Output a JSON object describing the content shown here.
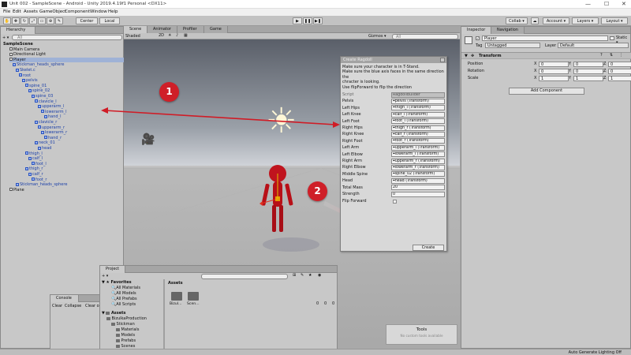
{
  "window": {
    "title": "Unit 002 - SampleScene - Android - Unity 2019.4.19f1 Personal <DX11>",
    "minimize": "—",
    "maximize": "☐",
    "close": "✕"
  },
  "menu": [
    "File",
    "Edit",
    "Assets",
    "GameObject",
    "Component",
    "Window",
    "Help"
  ],
  "toolbar": {
    "center_label": "Center",
    "local_label": "Local",
    "collab_label": "Collab ▾",
    "account_label": "Account ▾",
    "layers_label": "Layers ▾",
    "layout_label": "Layout ▾"
  },
  "hierarchy": {
    "tab": "Hierarchy",
    "search_placeholder": "All",
    "add_label": "+ ▾",
    "rows": [
      {
        "label": "SampleScene",
        "bold": true,
        "indent": 0,
        "blue": false,
        "icon": false
      },
      {
        "label": "Main Camera",
        "indent": 2,
        "blue": false,
        "icon": true
      },
      {
        "label": "Directional Light",
        "indent": 2,
        "blue": false,
        "icon": true
      },
      {
        "label": "Player",
        "indent": 2,
        "blue": false,
        "icon": true,
        "selected": true
      },
      {
        "label": "Stickman_heads_sphere",
        "indent": 3,
        "blue": true,
        "icon": true
      },
      {
        "label": "Skelet.c",
        "indent": 4,
        "blue": true,
        "icon": true
      },
      {
        "label": "root",
        "indent": 5,
        "blue": true,
        "icon": true
      },
      {
        "label": "pelvis",
        "indent": 6,
        "blue": true,
        "icon": true
      },
      {
        "label": "spine_01",
        "indent": 7,
        "blue": true,
        "icon": true
      },
      {
        "label": "spine_02",
        "indent": 8,
        "blue": true,
        "icon": true
      },
      {
        "label": "spine_03",
        "indent": 9,
        "blue": true,
        "icon": true
      },
      {
        "label": "clavicle_l",
        "indent": 10,
        "blue": true,
        "icon": true
      },
      {
        "label": "upperarm_l",
        "indent": 11,
        "blue": true,
        "icon": true
      },
      {
        "label": "lowerarm_l",
        "indent": 12,
        "blue": true,
        "icon": true
      },
      {
        "label": "hand_l",
        "indent": 13,
        "blue": true,
        "icon": true
      },
      {
        "label": "clavicle_r",
        "indent": 10,
        "blue": true,
        "icon": true
      },
      {
        "label": "upperarm_r",
        "indent": 11,
        "blue": true,
        "icon": true
      },
      {
        "label": "lowerarm_r",
        "indent": 12,
        "blue": true,
        "icon": true
      },
      {
        "label": "hand_r",
        "indent": 13,
        "blue": true,
        "icon": true
      },
      {
        "label": "neck_01",
        "indent": 10,
        "blue": true,
        "icon": true
      },
      {
        "label": "head",
        "indent": 11,
        "blue": true,
        "icon": true
      },
      {
        "label": "thigh_l",
        "indent": 7,
        "blue": true,
        "icon": true
      },
      {
        "label": "calf_l",
        "indent": 8,
        "blue": true,
        "icon": true
      },
      {
        "label": "foot_l",
        "indent": 9,
        "blue": true,
        "icon": true
      },
      {
        "label": "thigh_r",
        "indent": 7,
        "blue": true,
        "icon": true
      },
      {
        "label": "calf_r",
        "indent": 8,
        "blue": true,
        "icon": true
      },
      {
        "label": "foot_r",
        "indent": 9,
        "blue": true,
        "icon": true
      },
      {
        "label": "Stickman_heads_sphere",
        "indent": 4,
        "blue": true,
        "icon": true
      },
      {
        "label": "Plane",
        "indent": 2,
        "blue": false,
        "icon": true
      }
    ]
  },
  "scene": {
    "tabs": [
      "Scene",
      "Animator",
      "Profiler",
      "Game"
    ],
    "shading": "Shaded",
    "gizmos": "Gizmos ▾",
    "search_placeholder": "All"
  },
  "ragdoll": {
    "title": "Create Ragdoll",
    "help_lines": [
      "Make sure your character is in T-Stand.",
      "Make sure the blue axis faces in the same direction the",
      "chracter is looking.",
      "Use flipForward to flip the direction"
    ],
    "rows": [
      {
        "label": "Script",
        "value": "RagdollBuilder",
        "grey": true
      },
      {
        "label": "Pelvis",
        "value": "⌖pelvis (Transform)"
      },
      {
        "label": "Left Hips",
        "value": "⌖thigh_l (Transform)"
      },
      {
        "label": "Left Knee",
        "value": "⌖calf_l (Transform)"
      },
      {
        "label": "Left Foot",
        "value": "⌖foot_l (Transform)"
      },
      {
        "label": "Right Hips",
        "value": "⌖thigh_r (Transform)"
      },
      {
        "label": "Right Knee",
        "value": "⌖calf_r (Transform)"
      },
      {
        "label": "Right Foot",
        "value": "⌖foot_r (Transform)"
      },
      {
        "label": "Left Arm",
        "value": "⌖upperarm_l (Transform)"
      },
      {
        "label": "Left Elbow",
        "value": "⌖lowerarm_l (Transform)"
      },
      {
        "label": "Right Arm",
        "value": "⌖upperarm_r (Transform)"
      },
      {
        "label": "Right Elbow",
        "value": "⌖lowerarm_r (Transform)"
      },
      {
        "label": "Middle Spine",
        "value": "⌖spine_02 (Transform)"
      },
      {
        "label": "Head",
        "value": "⌖head (Transform)"
      },
      {
        "label": "Total Mass",
        "value": "20"
      },
      {
        "label": "Strength",
        "value": "0"
      }
    ],
    "flip_label": "Flip Forward",
    "create_label": "Create"
  },
  "annotations": {
    "one": "1",
    "two": "2",
    "color": "#c8202a"
  },
  "inspector": {
    "tabs": [
      "Inspector",
      "Navigation"
    ],
    "object_name": "Player",
    "static_label": "Static ▾",
    "tag_label": "Tag",
    "tag_value": "Untagged",
    "layer_label": "Layer",
    "layer_value": "Default",
    "transform_label": "Transform",
    "rows": [
      {
        "label": "Position",
        "x": "0",
        "y": "0",
        "z": "0"
      },
      {
        "label": "Rotation",
        "x": "0",
        "y": "0",
        "z": "0"
      },
      {
        "label": "Scale",
        "x": "1",
        "y": "1",
        "z": "1"
      }
    ],
    "add_component": "Add Component"
  },
  "console": {
    "tab": "Console",
    "buttons": [
      "Clear",
      "Collapse",
      "Clear on"
    ]
  },
  "project": {
    "tab": "Project",
    "favorites_label": "Favorites",
    "favorites": [
      "All Materials",
      "All Models",
      "All Prefabs",
      "All Scripts"
    ],
    "assets_label": "Assets",
    "tree": [
      {
        "label": "BizulkaProduction",
        "indent": 1
      },
      {
        "label": "Stickman",
        "indent": 2
      },
      {
        "label": "Materials",
        "indent": 3
      },
      {
        "label": "Models",
        "indent": 3
      },
      {
        "label": "Prefabs",
        "indent": 3
      },
      {
        "label": "Scenes",
        "indent": 3
      },
      {
        "label": "Scenes",
        "indent": 1
      }
    ],
    "breadcrumb": "Assets",
    "items": [
      "Bizul...",
      "Scen..."
    ],
    "counters": [
      "0",
      "0",
      "0"
    ]
  },
  "tools": {
    "title": "Tools",
    "subtitle": "No custom tools available"
  },
  "status": {
    "right": "Auto Generate Lighting Off"
  }
}
